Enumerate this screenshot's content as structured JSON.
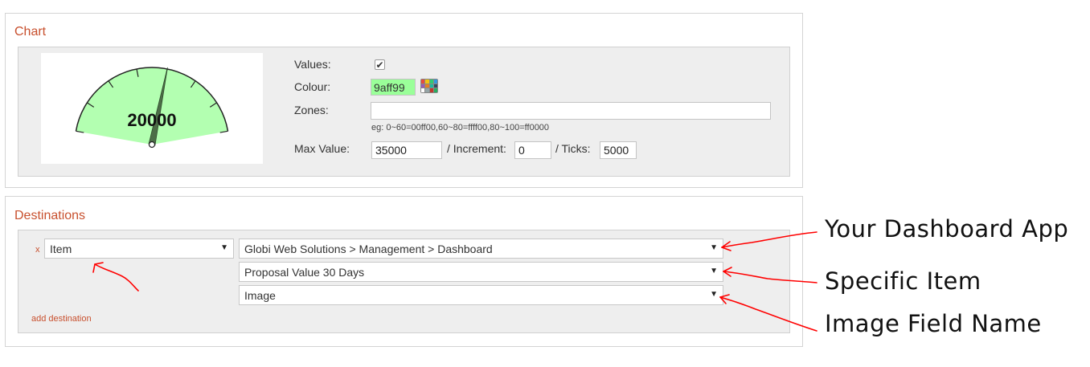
{
  "chart": {
    "title": "Chart",
    "gauge_value": "20000",
    "gauge_fraction": 0.5714,
    "gauge_fill_color": "#b3ffb1",
    "values_label": "Values:",
    "values_checked": true,
    "colour_label": "Colour:",
    "colour_value": "9aff99",
    "zones_label": "Zones:",
    "zones_value": "",
    "zones_hint": "eg: 0~60=00ff00,60~80=ffff00,80~100=ff0000",
    "max_label": "Max Value:",
    "max_value": "35000",
    "increment_label": "/ Increment:",
    "increment_value": "0",
    "ticks_label": "/ Ticks:",
    "ticks_value": "5000"
  },
  "destinations": {
    "title": "Destinations",
    "remove_label": "x",
    "type_select": "Item",
    "app_select": "Globi Web Solutions > Management > Dashboard",
    "item_select": "Proposal Value 30 Days",
    "field_select": "Image",
    "add_label": "add destination"
  },
  "annotations": {
    "app": "Your Dashboard App",
    "item": "Specific Item",
    "field": "Image Field Name"
  },
  "colors": {
    "accent": "#c8502e",
    "arrow": "#ff0000"
  }
}
